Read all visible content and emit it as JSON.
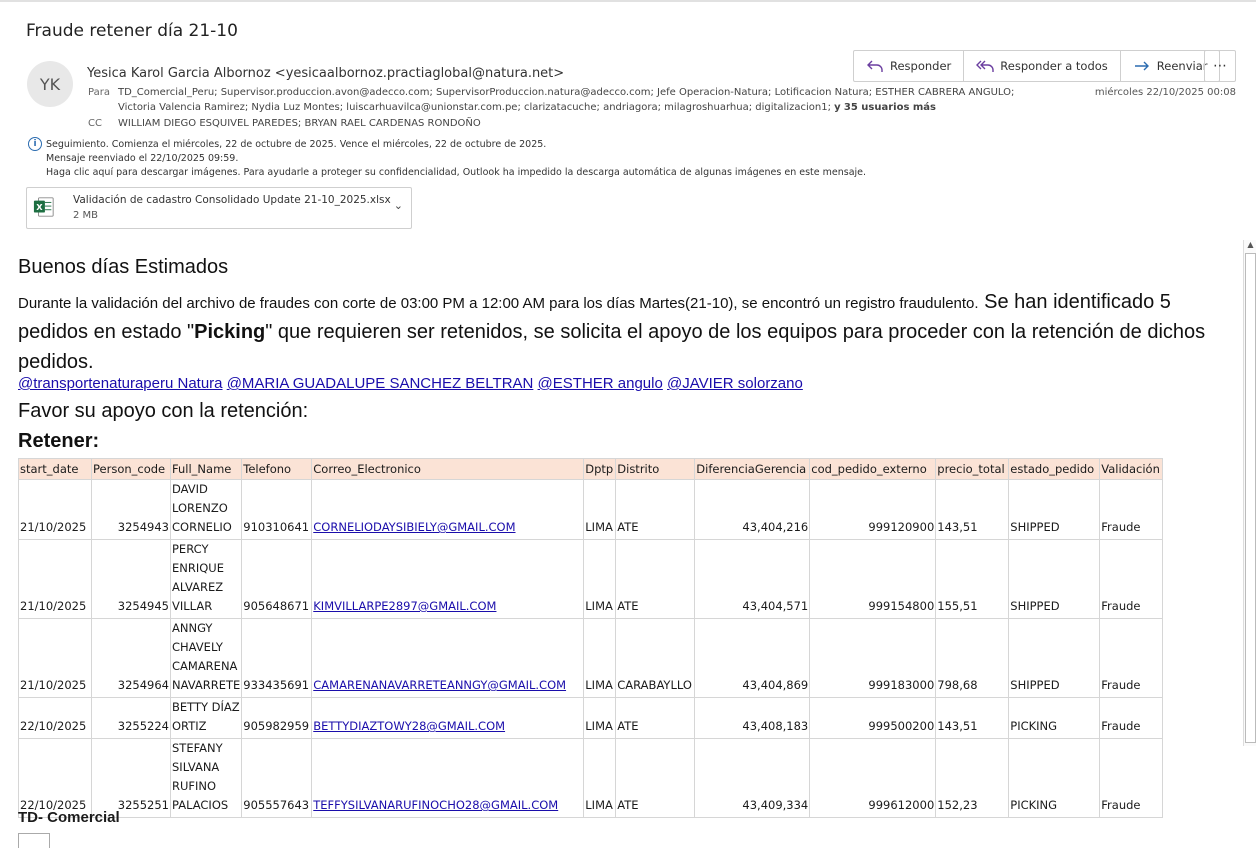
{
  "subject": "Fraude retener día 21-10",
  "avatar_initials": "YK",
  "sender": "Yesica Karol Garcia Albornoz <yesicaalbornoz.practiaglobal@natura.net>",
  "to_label": "Para",
  "to_line1": "TD_Comercial_Peru; Supervisor.produccion.avon@adecco.com; SupervisorProduccion.natura@adecco.com; Jefe Operacion-Natura; Lotificacion Natura; ESTHER CABRERA ANGULO;",
  "to_line2": "Victoria Valencia Ramirez; Nydia Luz Montes; luiscarhuavilca@unionstar.com.pe; clarizatacuche; andriagora; milagroshuarhua; digitalizacion1;",
  "to_more_prefix": "y",
  "to_more": "35 usuarios más",
  "cc_label": "CC",
  "cc_line": "WILLIAM DIEGO ESQUIVEL PAREDES; BRYAN RAEL CARDENAS RONDOÑO",
  "date": "miércoles 22/10/2025 00:08",
  "actions": {
    "reply": "Responder",
    "reply_all": "Responder a todos",
    "forward": "Reenviar",
    "more": "⋯"
  },
  "info_lines": [
    "Seguimiento.  Comienza el miércoles, 22 de octubre de 2025.  Vence el miércoles, 22 de octubre de 2025.",
    "Mensaje reenviado el 22/10/2025 09:59.",
    "Haga clic aquí para descargar imágenes. Para ayudarle a proteger su confidencialidad, Outlook ha impedido la descarga automática de algunas imágenes en este mensaje."
  ],
  "attachment": {
    "name": "Validación de cadastro Consolidado Update 21-10_2025.xlsx",
    "size": "2 MB",
    "icon_letter": "X"
  },
  "body": {
    "greeting": "Buenos días Estimados",
    "intro_small": "Durante la validación del archivo de fraudes con corte de 03:00 PM a 12:00 AM para los días Martes(21-10), se encontró un registro fraudulento.",
    "intro_big_1": " Se han identificado 5 pedidos en estado \"",
    "intro_bold": "Picking",
    "intro_big_2": "\" que requieren ser retenidos, se solicita el apoyo de los equipos para proceder con la retención de dichos pedidos.",
    "mentions": [
      "@transportenaturaperu Natura",
      "@MARIA GUADALUPE SANCHEZ BELTRAN",
      "@ESTHER angulo",
      "@JAVIER solorzano"
    ],
    "request": "Favor su apoyo con la retención:",
    "retain": "Retener:",
    "signature": "TD- Comercial"
  },
  "table": {
    "headers": [
      "start_date",
      "Person_code",
      "Full_Name",
      "Telefono",
      "Correo_Electronico",
      "Dptp",
      "Distrito",
      "DiferenciaGerencia",
      "cod_pedido_externo",
      "precio_total",
      "estado_pedido",
      "Validación"
    ],
    "rows": [
      [
        "21/10/2025",
        "3254943",
        "DAVID LORENZO CORNELIO",
        "910310641",
        "CORNELIODAYSIBIELY@GMAIL.COM",
        "LIMA",
        "ATE",
        "43,404,216",
        "999120900",
        "143,51",
        "SHIPPED",
        "Fraude"
      ],
      [
        "21/10/2025",
        "3254945",
        "PERCY ENRIQUE ALVAREZ VILLAR",
        "905648671",
        "KIMVILLARPE2897@GMAIL.COM",
        "LIMA",
        "ATE",
        "43,404,571",
        "999154800",
        "155,51",
        "SHIPPED",
        "Fraude"
      ],
      [
        "21/10/2025",
        "3254964",
        "ANNGY CHAVELY CAMARENA NAVARRETE",
        "933435691",
        "CAMARENANAVARRETEANNGY@GMAIL.COM",
        "LIMA",
        "CARABAYLLO",
        "43,404,869",
        "999183000",
        "798,68",
        "SHIPPED",
        "Fraude"
      ],
      [
        "22/10/2025",
        "3255224",
        "BETTY DÍAZ ORTIZ",
        "905982959",
        "BETTYDIAZTOWY28@GMAIL.COM",
        "LIMA",
        "ATE",
        "43,408,183",
        "999500200",
        "143,51",
        "PICKING",
        "Fraude"
      ],
      [
        "22/10/2025",
        "3255251",
        "STEFANY SILVANA RUFINO PALACIOS",
        "905557643",
        "TEFFYSILVANARUFINOCHO28@GMAIL.COM",
        "LIMA",
        "ATE",
        "43,409,334",
        "999612000",
        "152,23",
        "PICKING",
        "Fraude"
      ]
    ]
  }
}
